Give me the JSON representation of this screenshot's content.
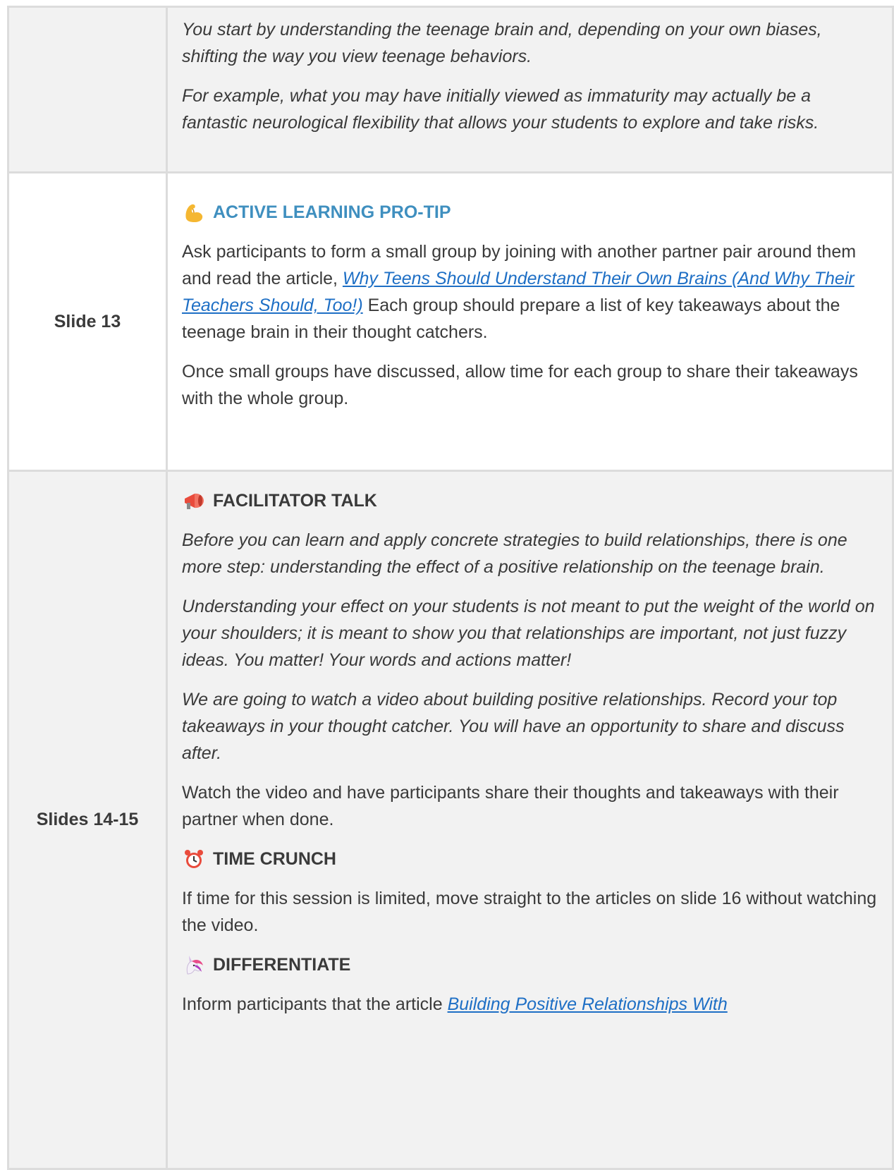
{
  "rows": [
    {
      "label": "",
      "paragraphs": [
        "You start by understanding the teenage brain and, depending on your own biases, shifting the way you view teenage behaviors.",
        "For example, what you may have initially viewed as immaturity may actually be a fantastic neurological flexibility that allows your students to explore and take risks."
      ]
    },
    {
      "label": "Slide 13",
      "heading": "ACTIVE LEARNING PRO-TIP",
      "heading_icon": "flexed-biceps-icon",
      "p1_before": "Ask participants to form a small group by joining with another partner pair around them and read the article, ",
      "p1_link": "Why Teens Should Understand Their Own Brains (And Why Their Teachers Should, Too!)",
      "p1_after": " Each group should prepare a list of key takeaways about the teenage brain in their thought catchers.",
      "p2": "Once small groups have discussed, allow time for each group to share their takeaways with the whole group."
    },
    {
      "label": "Slides 14-15",
      "heading1": "FACILITATOR TALK",
      "heading1_icon": "megaphone-icon",
      "talk": [
        "Before you can learn and apply concrete strategies to build relationships, there is one more step: understanding the effect of a positive relationship on the teenage brain.",
        "Understanding your effect on your students is not meant to put the weight of the world on your shoulders; it is meant to show you that relationships are important, not just fuzzy ideas. You matter! Your words and actions matter!",
        "We are going to watch a video about building positive relationships. Record your top takeaways in your thought catcher. You will have an opportunity to share and discuss after."
      ],
      "watch": "Watch the video and have participants share their thoughts and takeaways with their partner when done.",
      "heading2": "TIME CRUNCH",
      "heading2_icon": "alarm-clock-icon",
      "crunch": "If time for this session is limited, move straight to the articles on slide 16 without watching the video.",
      "heading3": "DIFFERENTIATE",
      "heading3_icon": "unicorn-icon",
      "diff_before": "Inform participants that the article ",
      "diff_link": "Building Positive Relationships With"
    }
  ],
  "colors": {
    "accent_blue": "#3f8fbf",
    "link": "#1e6fc5",
    "row_gray": "#f2f2f2",
    "border": "#dcdcdc"
  }
}
